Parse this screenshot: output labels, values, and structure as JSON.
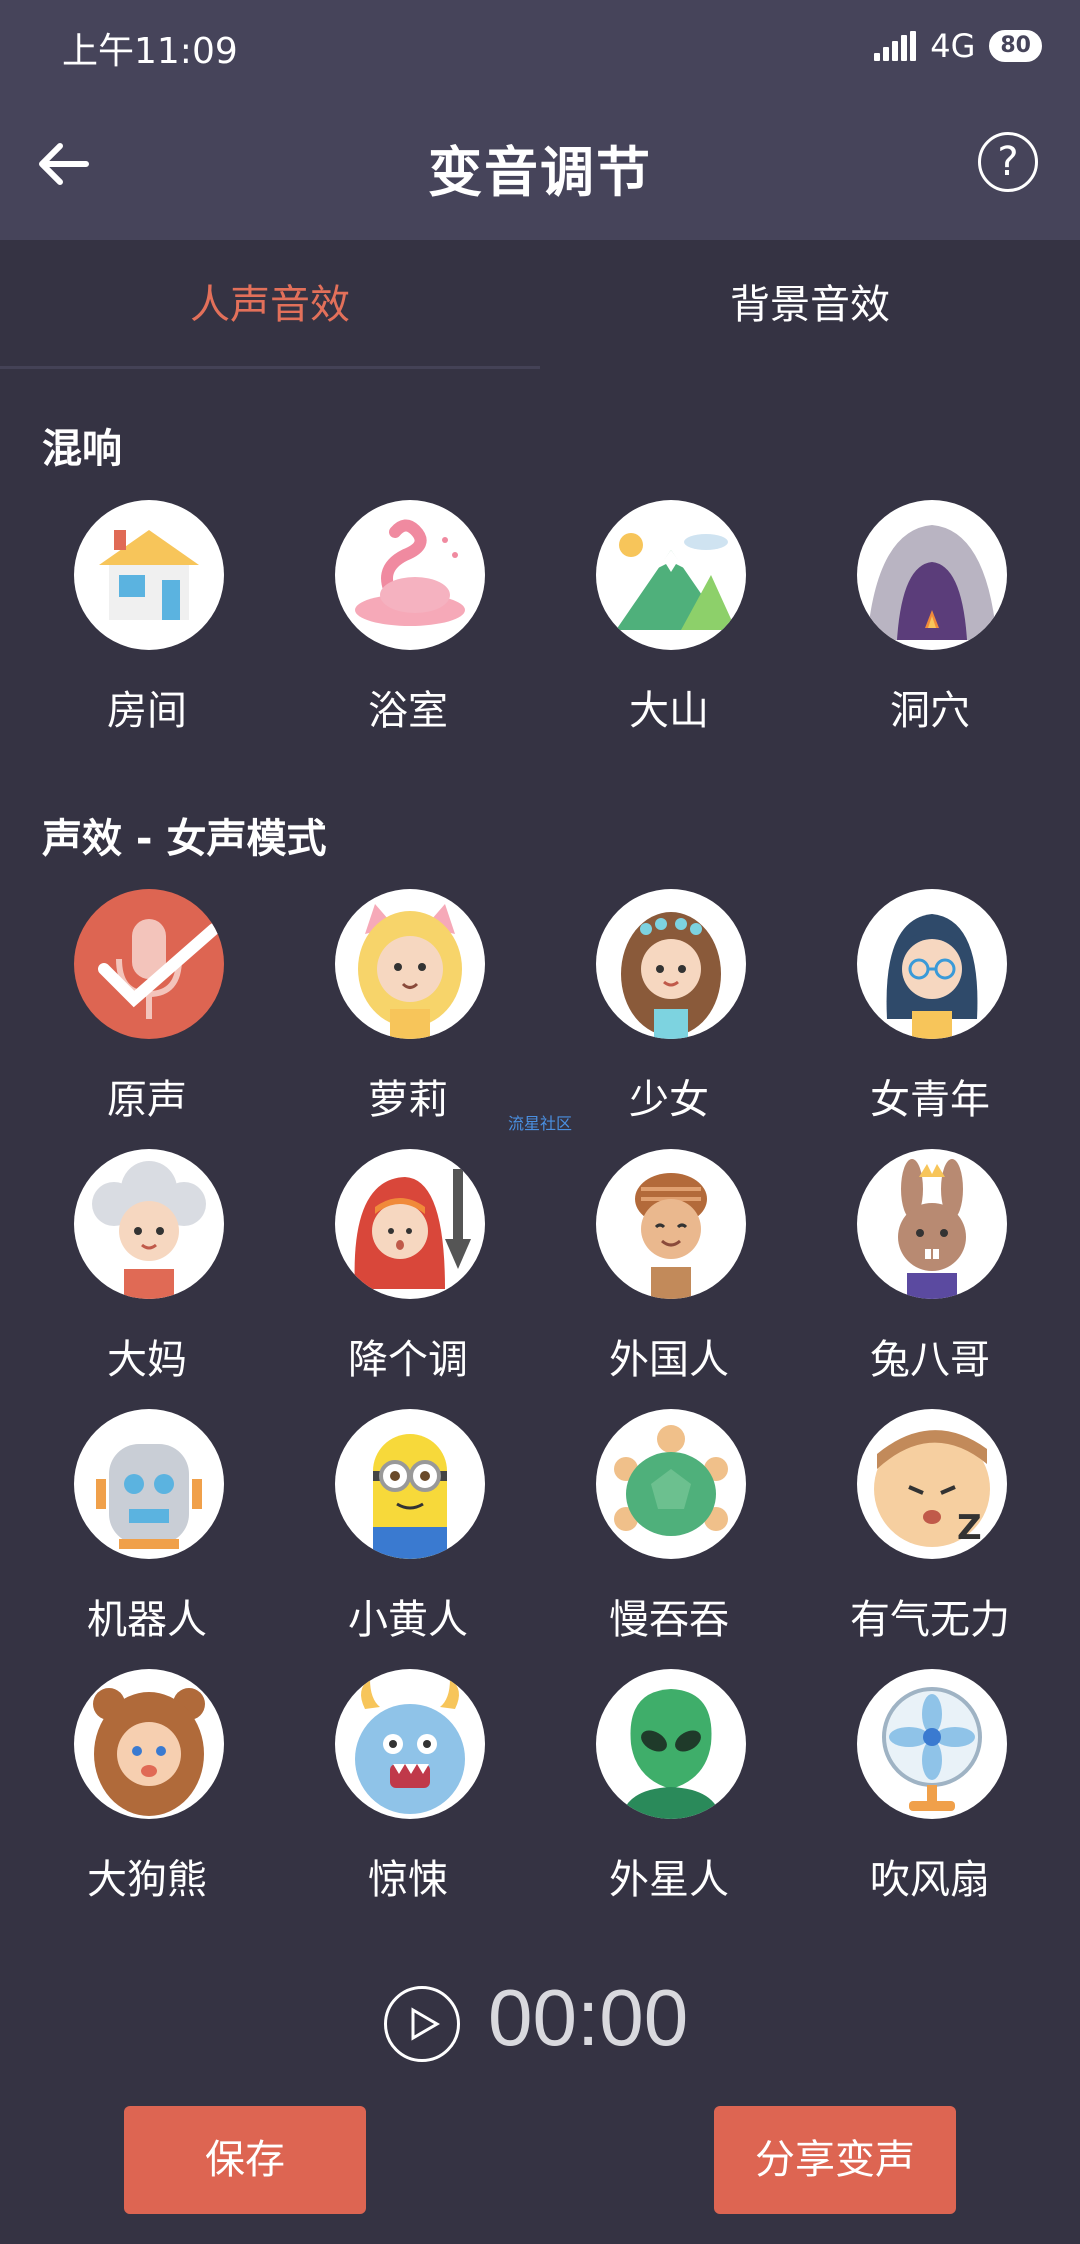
{
  "status_bar": {
    "time": "上午11:09",
    "network": "4G",
    "battery": "80"
  },
  "header": {
    "title": "变音调节",
    "back_icon": "arrow-left-icon",
    "help_icon": "question-circle-icon"
  },
  "tabs": [
    {
      "label": "人声音效",
      "active": true
    },
    {
      "label": "背景音效",
      "active": false
    }
  ],
  "sections": {
    "reverb": {
      "title": "混响",
      "items": [
        {
          "label": "房间",
          "icon": "house-icon"
        },
        {
          "label": "浴室",
          "icon": "flamingo-icon"
        },
        {
          "label": "大山",
          "icon": "mountain-icon"
        },
        {
          "label": "洞穴",
          "icon": "cave-icon"
        }
      ]
    },
    "female_effects": {
      "title": "声效 - 女声模式",
      "items": [
        {
          "label": "原声",
          "icon": "microphone-icon",
          "selected": true
        },
        {
          "label": "萝莉",
          "icon": "cat-girl-icon"
        },
        {
          "label": "少女",
          "icon": "girl-flower-crown-icon"
        },
        {
          "label": "女青年",
          "icon": "young-woman-glasses-icon"
        },
        {
          "label": "大妈",
          "icon": "grandma-icon"
        },
        {
          "label": "降个调",
          "icon": "red-hood-arrow-down-icon"
        },
        {
          "label": "外国人",
          "icon": "foreigner-icon"
        },
        {
          "label": "兔八哥",
          "icon": "bunny-king-icon"
        },
        {
          "label": "机器人",
          "icon": "robot-icon"
        },
        {
          "label": "小黄人",
          "icon": "minion-icon"
        },
        {
          "label": "慢吞吞",
          "icon": "turtle-icon"
        },
        {
          "label": "有气无力",
          "icon": "sleepy-face-icon"
        },
        {
          "label": "大狗熊",
          "icon": "bear-costume-icon"
        },
        {
          "label": "惊悚",
          "icon": "monster-icon"
        },
        {
          "label": "外星人",
          "icon": "alien-icon"
        },
        {
          "label": "吹风扇",
          "icon": "fan-icon"
        }
      ]
    }
  },
  "watermark": "流星社区",
  "player": {
    "time": "00:00",
    "play_icon": "play-icon"
  },
  "buttons": {
    "save": "保存",
    "share": "分享变声"
  },
  "colors": {
    "background": "#353343",
    "header": "#46445a",
    "accent": "#e3705a",
    "button": "#dd6552"
  }
}
